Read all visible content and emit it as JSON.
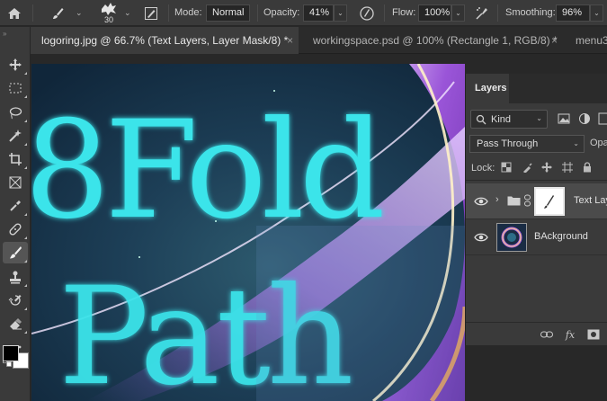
{
  "options_bar": {
    "brush_size": "30",
    "mode_label": "Mode:",
    "mode_value": "Normal",
    "opacity_label": "Opacity:",
    "opacity_value": "41%",
    "flow_label": "Flow:",
    "flow_value": "100%",
    "smoothing_label": "Smoothing:",
    "smoothing_value": "96%"
  },
  "tabs": [
    {
      "label": "logoring.jpg @ 66.7% (Text Layers, Layer Mask/8) *",
      "close": "×",
      "active": true
    },
    {
      "label": "workingspace.psd @ 100% (Rectangle 1, RGB/8) *",
      "close": "×",
      "active": false
    },
    {
      "label": "menu3",
      "active": false
    }
  ],
  "toolbar": {
    "tools": [
      "move-tool",
      "marquee-tool",
      "lasso-tool",
      "magic-wand-tool",
      "crop-tool",
      "frame-tool",
      "eyedropper-tool",
      "healing-brush-tool",
      "brush-tool",
      "clone-stamp-tool",
      "history-brush-tool",
      "eraser-tool",
      "more-tools"
    ],
    "active_tool": "brush-tool",
    "foreground_color": "#000000",
    "background_color": "#ffffff"
  },
  "canvas": {
    "artwork_text_line1": "8Fold",
    "artwork_text_line2": "Path",
    "glow_color": "#37e6ec",
    "ring_color": "#a55fd8"
  },
  "layers_panel": {
    "tab_label": "Layers",
    "filter_label": "Kind",
    "blend_mode": "Pass Through",
    "opacity_label": "Opa",
    "lock_label": "Lock:",
    "layers": [
      {
        "name": "Text Layers",
        "type": "group",
        "selected": true,
        "visible": true
      },
      {
        "name": "BAckground",
        "type": "image",
        "selected": false,
        "visible": true
      }
    ],
    "bottom_icons": [
      "link-icon",
      "fx-icon",
      "mask-icon"
    ],
    "fx_label": "fx"
  }
}
